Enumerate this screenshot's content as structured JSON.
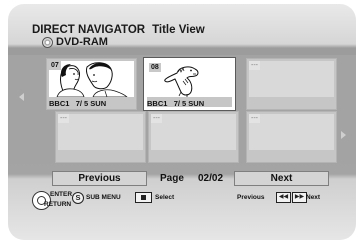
{
  "header": {
    "title": "DIRECT NAVIGATOR",
    "view": "Title View",
    "media": "DVD-RAM"
  },
  "titles": [
    {
      "number": "07",
      "channel": "BBC1",
      "date": "7/ 5 SUN",
      "selected": false,
      "has_content": true
    },
    {
      "number": "08",
      "channel": "BBC1",
      "date": "7/ 5 SUN",
      "selected": true,
      "has_content": true
    },
    {
      "number": "---",
      "channel": "",
      "date": "",
      "selected": false,
      "has_content": false
    },
    {
      "number": "---",
      "channel": "",
      "date": "",
      "selected": false,
      "has_content": false
    },
    {
      "number": "---",
      "channel": "",
      "date": "",
      "selected": false,
      "has_content": false
    },
    {
      "number": "---",
      "channel": "",
      "date": "",
      "selected": false,
      "has_content": false
    }
  ],
  "pager": {
    "previous_label": "Previous",
    "page_label": "Page",
    "page_value": "02/02",
    "next_label": "Next"
  },
  "footer": {
    "enter_label": "ENTER",
    "return_label": "RETURN",
    "s_icon": "S",
    "sub_menu_label": "SUB MENU",
    "select_label": "Select",
    "previous_label": "Previous",
    "next_label": "Next",
    "skip_back_icon": "◀◀",
    "skip_fwd_icon": "▶▶"
  },
  "colors": {
    "selection_border": "#ffffff",
    "background": "#a3a3a3"
  }
}
